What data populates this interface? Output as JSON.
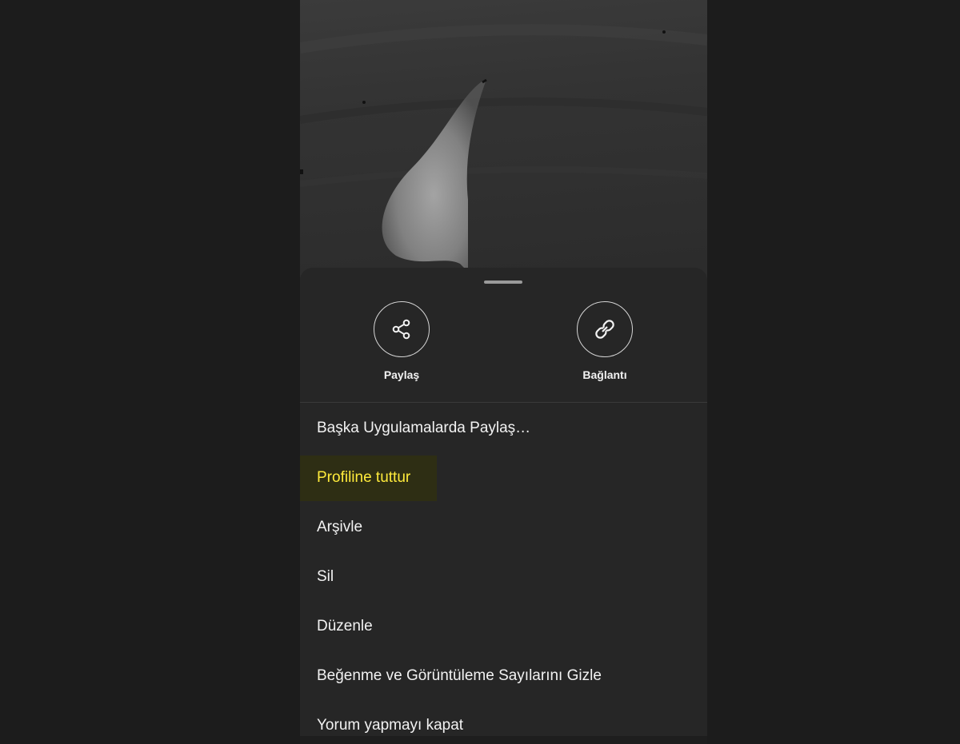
{
  "photo": {
    "description_icon": "photo-preview"
  },
  "actions": [
    {
      "label": "Paylaş",
      "icon": "share-icon"
    },
    {
      "label": "Bağlantı",
      "icon": "link-icon"
    }
  ],
  "menu": {
    "items": [
      {
        "label": "Başka Uygulamalarda Paylaş…"
      },
      {
        "label": "Profiline tuttur",
        "highlighted": true
      },
      {
        "label": "Arşivle"
      },
      {
        "label": "Sil"
      },
      {
        "label": "Düzenle"
      },
      {
        "label": "Beğenme ve Görüntüleme Sayılarını Gizle"
      },
      {
        "label": "Yorum yapmayı kapat"
      }
    ]
  },
  "colors": {
    "background": "#1c1c1c",
    "sheet": "#262626",
    "text": "#f2f2f2",
    "highlight_text": "#ffeb3b",
    "highlight_bg": "#2e2e14"
  }
}
